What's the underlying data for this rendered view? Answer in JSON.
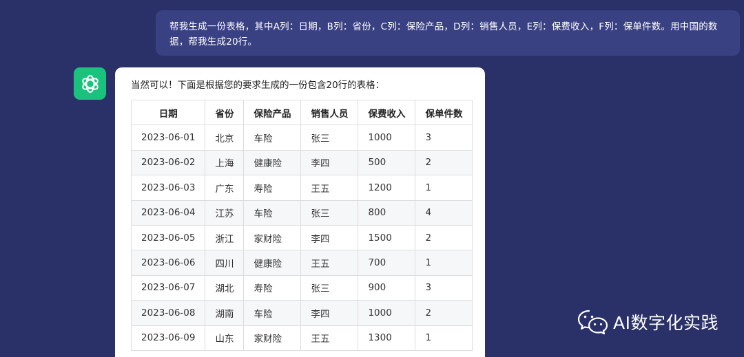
{
  "user_message": {
    "text": "帮我生成一份表格，其中A列：日期，B列：省份，C列：保险产品，D列：销售人员，E列：保费收入，F列：保单件数。用中国的数据，帮我生成20行。"
  },
  "assistant": {
    "avatar_icon": "openai-logo-icon",
    "avatar_color": "#19c37d",
    "intro": "当然可以！下面是根据您的要求生成的一份包含20行的表格：",
    "table": {
      "headers": [
        "日期",
        "省份",
        "保险产品",
        "销售人员",
        "保费收入",
        "保单件数"
      ],
      "rows": [
        [
          "2023-06-01",
          "北京",
          "车险",
          "张三",
          "1000",
          "3"
        ],
        [
          "2023-06-02",
          "上海",
          "健康险",
          "李四",
          "500",
          "2"
        ],
        [
          "2023-06-03",
          "广东",
          "寿险",
          "王五",
          "1200",
          "1"
        ],
        [
          "2023-06-04",
          "江苏",
          "车险",
          "张三",
          "800",
          "4"
        ],
        [
          "2023-06-05",
          "浙江",
          "家财险",
          "李四",
          "1500",
          "2"
        ],
        [
          "2023-06-06",
          "四川",
          "健康险",
          "王五",
          "700",
          "1"
        ],
        [
          "2023-06-07",
          "湖北",
          "寿险",
          "张三",
          "900",
          "3"
        ],
        [
          "2023-06-08",
          "湖南",
          "车险",
          "李四",
          "1000",
          "2"
        ],
        [
          "2023-06-09",
          "山东",
          "家财险",
          "王五",
          "1300",
          "1"
        ]
      ]
    }
  },
  "watermark": {
    "icon": "wechat-icon",
    "text": "AI数字化实践"
  },
  "colors": {
    "background": "#2a3068",
    "user_bubble": "#3a4183",
    "card": "#ffffff",
    "accent": "#19c37d"
  }
}
